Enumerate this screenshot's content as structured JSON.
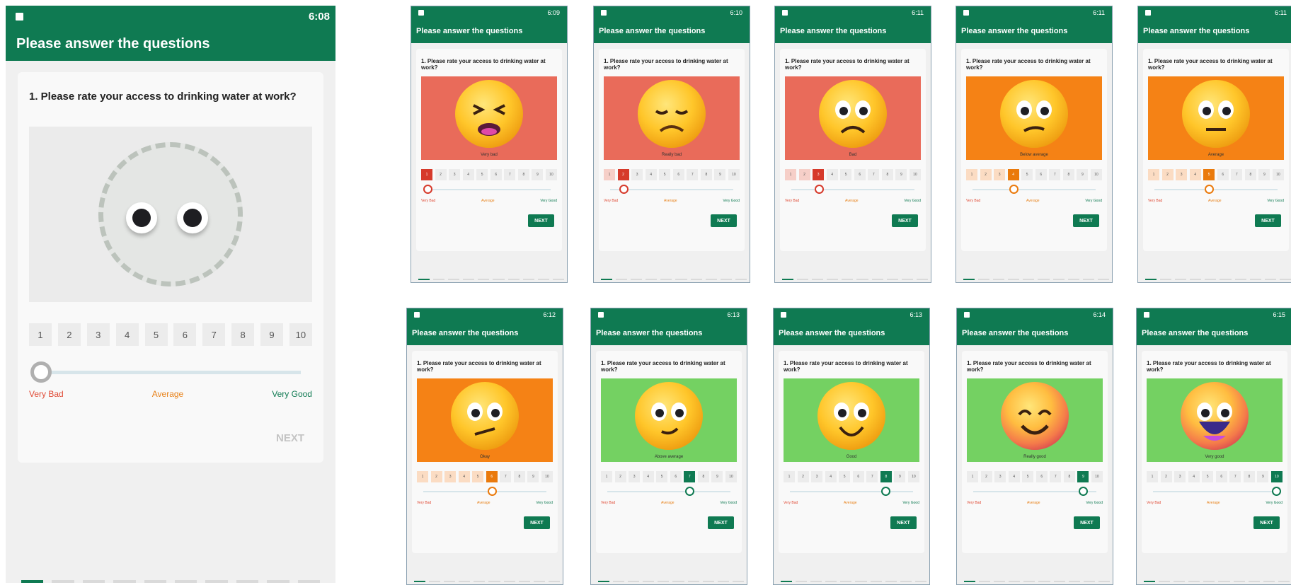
{
  "main": {
    "time": "6:08",
    "title": "Please answer the questions",
    "question": "1. Please rate your access to drinking water at work?",
    "numbers": [
      "1",
      "2",
      "3",
      "4",
      "5",
      "6",
      "7",
      "8",
      "9",
      "10"
    ],
    "label_bad": "Very Bad",
    "label_avg": "Average",
    "label_good": "Very Good",
    "next": "NEXT",
    "slider_value": 1
  },
  "thumbs": [
    {
      "time": "6:09",
      "caption": "Very bad",
      "value": 1,
      "color": "#e96b5a",
      "accent": "#d63a2b"
    },
    {
      "time": "6:10",
      "caption": "Really bad",
      "value": 2,
      "color": "#e96b5a",
      "accent": "#d63a2b"
    },
    {
      "time": "6:11",
      "caption": "Bad",
      "value": 3,
      "color": "#e96b5a",
      "accent": "#d63a2b"
    },
    {
      "time": "6:11",
      "caption": "Below average",
      "value": 4,
      "color": "#f58215",
      "accent": "#ea7a0c"
    },
    {
      "time": "6:11",
      "caption": "Average",
      "value": 5,
      "color": "#f58215",
      "accent": "#ea7a0c"
    },
    {
      "time": "6:12",
      "caption": "Okay",
      "value": 6,
      "color": "#f58215",
      "accent": "#ea7a0c"
    },
    {
      "time": "6:13",
      "caption": "Above average",
      "value": 7,
      "color": "#74d162",
      "accent": "#0f7a52"
    },
    {
      "time": "6:13",
      "caption": "Good",
      "value": 8,
      "color": "#74d162",
      "accent": "#0f7a52"
    },
    {
      "time": "6:14",
      "caption": "Really good",
      "value": 9,
      "color": "#74d162",
      "accent": "#0f7a52"
    },
    {
      "time": "6:15",
      "caption": "Very good",
      "value": 10,
      "color": "#74d162",
      "accent": "#0f7a52"
    }
  ]
}
